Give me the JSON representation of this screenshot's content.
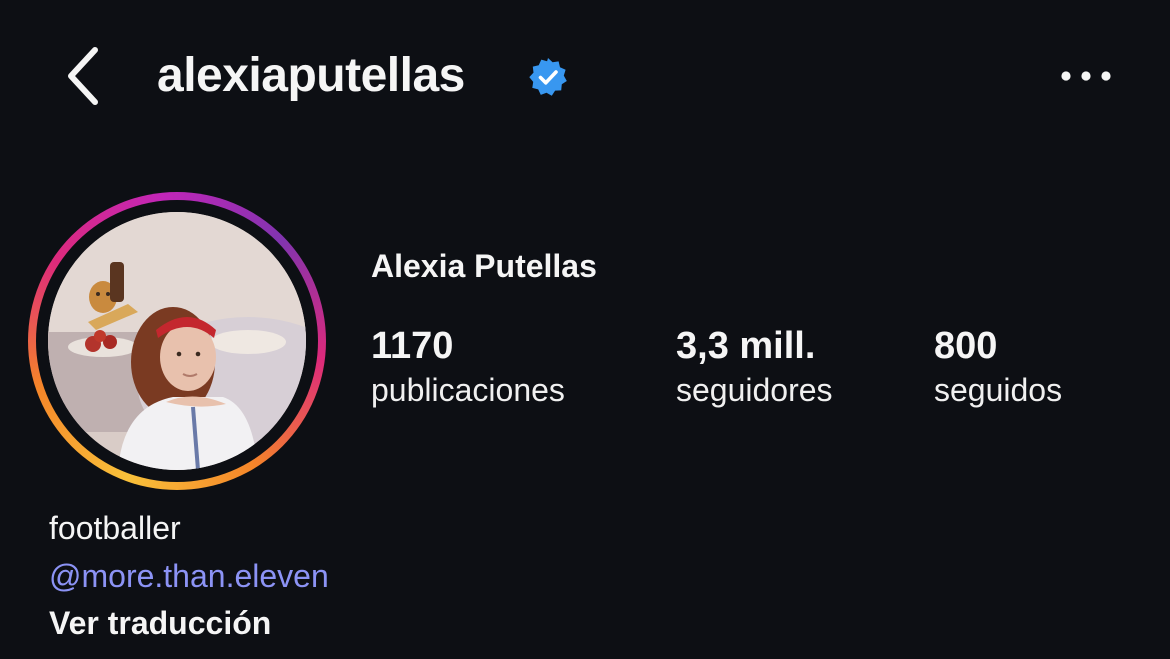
{
  "header": {
    "username": "alexiaputellas",
    "back_icon": "chevron-left-icon",
    "verified_icon": "verified-badge-icon",
    "more_icon": "more-horizontal-icon"
  },
  "profile": {
    "full_name": "Alexia Putellas",
    "avatar": "profile-photo",
    "story_ring_colors": [
      "#f9c13a",
      "#f58529",
      "#dd2a7b",
      "#c226b8",
      "#8134af"
    ],
    "stats": [
      {
        "value": "1170",
        "label": "publicaciones"
      },
      {
        "value": "3,3 mill.",
        "label": "seguidores"
      },
      {
        "value": "800",
        "label": "seguidos"
      }
    ]
  },
  "bio": {
    "text": "footballer",
    "mention": "@more.than.eleven",
    "translate": "Ver traducción"
  },
  "colors": {
    "background": "#0d0f14",
    "text": "#f5f5f5",
    "link": "#8c93f5",
    "verified": "#3897f0"
  }
}
